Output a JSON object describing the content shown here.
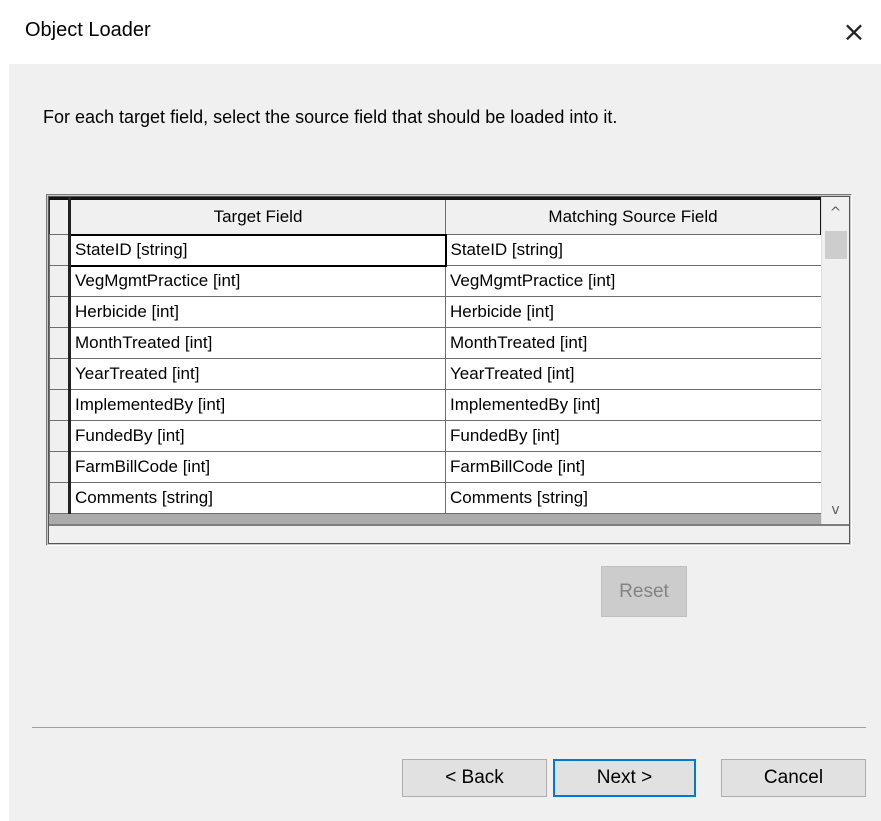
{
  "window": {
    "title": "Object Loader",
    "close_glyph": "×"
  },
  "instruction": "For each target field, select the source field that should be loaded into it.",
  "grid": {
    "columns": [
      "Target Field",
      "Matching Source Field"
    ],
    "rows": [
      {
        "target": "StateID [string]",
        "source": "StateID [string]"
      },
      {
        "target": "VegMgmtPractice [int]",
        "source": "VegMgmtPractice [int]"
      },
      {
        "target": "Herbicide [int]",
        "source": "Herbicide [int]"
      },
      {
        "target": "MonthTreated [int]",
        "source": "MonthTreated [int]"
      },
      {
        "target": "YearTreated [int]",
        "source": "YearTreated [int]"
      },
      {
        "target": "ImplementedBy [int]",
        "source": "ImplementedBy [int]"
      },
      {
        "target": "FundedBy [int]",
        "source": "FundedBy [int]"
      },
      {
        "target": "FarmBillCode [int]",
        "source": "FarmBillCode [int]"
      },
      {
        "target": "Comments [string]",
        "source": "Comments [string]"
      }
    ],
    "scroll_up_glyph": "^",
    "scroll_down_glyph": "v"
  },
  "buttons": {
    "reset": "Reset",
    "back": "< Back",
    "next": "Next >",
    "cancel": "Cancel"
  }
}
